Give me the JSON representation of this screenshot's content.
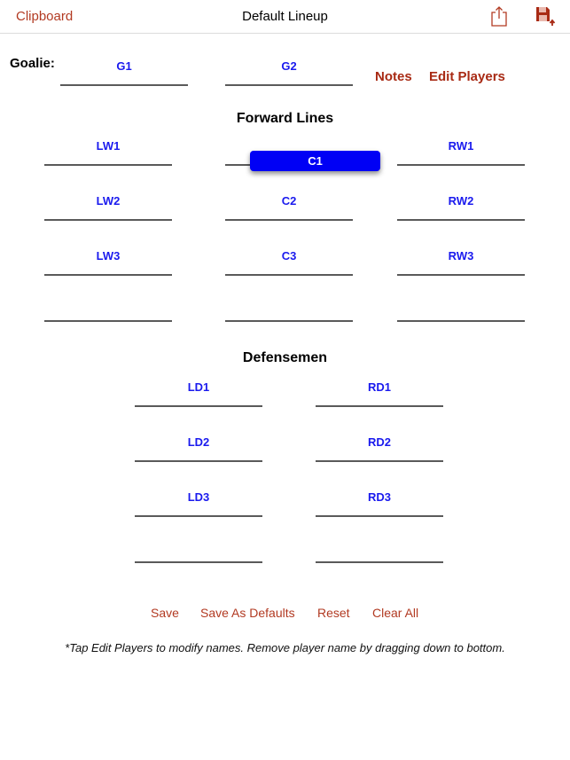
{
  "navbar": {
    "left_button": "Clipboard",
    "title": "Default Lineup",
    "icons": [
      "share-icon",
      "save-icon"
    ],
    "accent_color": "#b23a22"
  },
  "goalie": {
    "label": "Goalie:",
    "slots": [
      "G1",
      "G2"
    ],
    "notes_button": "Notes",
    "edit_players_button": "Edit Players"
  },
  "forwards": {
    "title": "Forward Lines",
    "rows": [
      [
        "LW1",
        "",
        "RW1"
      ],
      [
        "LW2",
        "C2",
        "RW2"
      ],
      [
        "LW3",
        "C3",
        "RW3"
      ],
      [
        "",
        "",
        ""
      ]
    ],
    "dragging_chip": "C1"
  },
  "defense": {
    "title": "Defensemen",
    "rows": [
      [
        "LD1",
        "RD1"
      ],
      [
        "LD2",
        "RD2"
      ],
      [
        "LD3",
        "RD3"
      ],
      [
        "",
        ""
      ]
    ]
  },
  "actions": {
    "save": "Save",
    "save_as_defaults": "Save As Defaults",
    "reset": "Reset",
    "clear_all": "Clear All"
  },
  "footnote": "*Tap Edit Players to modify names.  Remove player name by dragging down to bottom.",
  "colors": {
    "slot_label": "#1a1aee",
    "chip": "#0000f5",
    "link": "#a82a14"
  }
}
